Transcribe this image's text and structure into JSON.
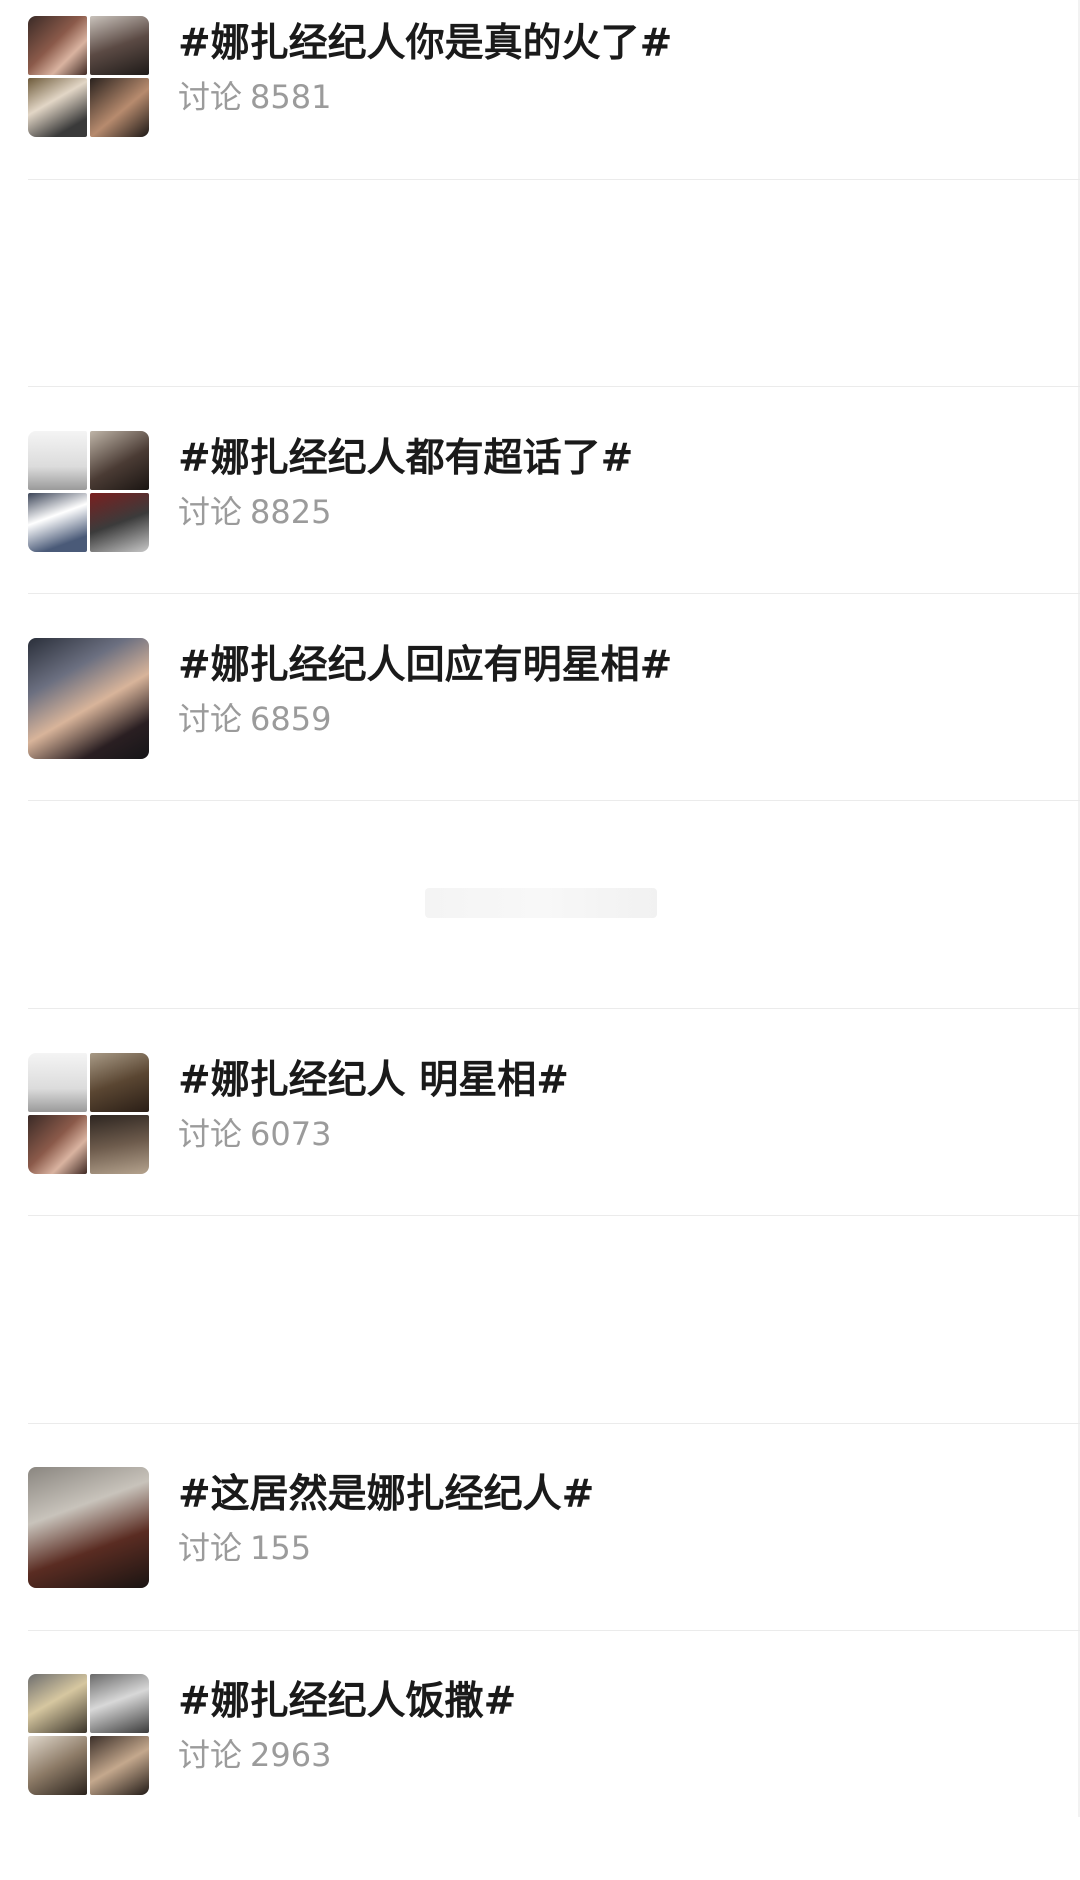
{
  "topics": [
    {
      "title": "#娜扎经纪人你是真的火了#",
      "count_label": "讨论",
      "count": "8581"
    },
    {
      "title": "#娜扎经纪人都有超话了#",
      "count_label": "讨论",
      "count": "8825"
    },
    {
      "title": "#娜扎经纪人回应有明星相#",
      "count_label": "讨论",
      "count": "6859"
    },
    {
      "title": "#娜扎经纪人 明星相#",
      "count_label": "讨论",
      "count": "6073"
    },
    {
      "title": "#这居然是娜扎经纪人#",
      "count_label": "讨论",
      "count": "155"
    },
    {
      "title": "#娜扎经纪人饭撒#",
      "count_label": "讨论",
      "count": "2963"
    }
  ]
}
